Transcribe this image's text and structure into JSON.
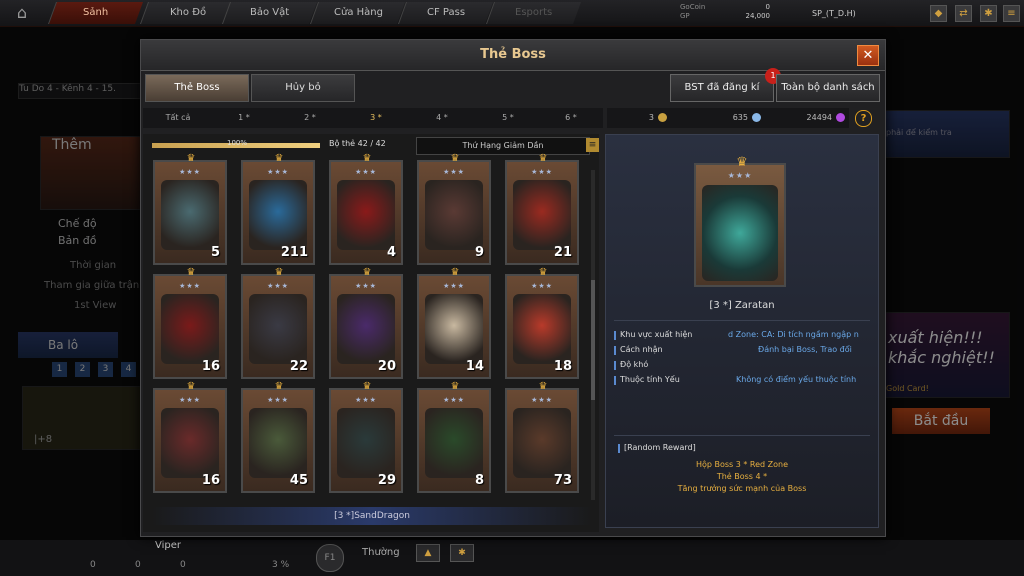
{
  "topnav": {
    "tabs": [
      "Sảnh",
      "Kho Đồ",
      "Bảo Vật",
      "Cửa Hàng",
      "CF Pass",
      "Esports"
    ],
    "gocoin_label": "GoCoin",
    "gp_label": "GP",
    "gocoin_value": "0",
    "gp_value": "24,000",
    "player": "SP_(T_D.H)"
  },
  "background": {
    "channel": "Tu Do 4 - Kênh 4 - 15.",
    "them": "Thêm",
    "che_do": "Chế độ",
    "ban_do": "Bản đồ",
    "thoi_gian": "Thời gian",
    "tham_gia": "Tham gia giữa trận",
    "first_view": "1st View",
    "ba_lo": "Ba lô",
    "slots": [
      "1",
      "2",
      "3",
      "4"
    ],
    "plus8": "|+8",
    "hint": "phải để kiểm tra",
    "xuat_hien": "xuất hiện!!!",
    "khac_nghiet": "khắc nghiệt!!",
    "gold_card": "Gold Card!",
    "bat_dau": "Bắt đầu",
    "viper": "Viper",
    "mode": "Thường",
    "percent": "3 %",
    "zeros": [
      "0",
      "0",
      "0"
    ]
  },
  "modal": {
    "title": "Thẻ Boss",
    "close": "✕",
    "tabs": [
      "Thẻ Boss",
      "Hủy bỏ"
    ],
    "btn_registered": "BST đã đăng kí",
    "btn_registered_badge": "1",
    "btn_all": "Toàn bộ danh sách",
    "filters": [
      "Tất cả",
      "1 *",
      "2 *",
      "3 *",
      "4 *",
      "5 *",
      "6 *"
    ],
    "selected_filter": 3,
    "resources": [
      "3",
      "635",
      "24494"
    ],
    "help": "?",
    "progress_pct_label": "100%",
    "progress_fraction": 1.0,
    "set_count": "Bộ thẻ 42 / 42",
    "sort_label": "Thứ Hạng Giảm Dần",
    "selected_card_name": "[3 *]SandDragon"
  },
  "cards": [
    {
      "count": "5",
      "color": "#4a6a70"
    },
    {
      "count": "211",
      "color": "#2a6a9a"
    },
    {
      "count": "4",
      "color": "#8a1a1a"
    },
    {
      "count": "9",
      "color": "#5a3a34"
    },
    {
      "count": "21",
      "color": "#9a2a20"
    },
    {
      "count": "16",
      "color": "#7a1a1a"
    },
    {
      "count": "22",
      "color": "#3a3a44"
    },
    {
      "count": "20",
      "color": "#4a2a6a"
    },
    {
      "count": "14",
      "color": "#c8b8a0"
    },
    {
      "count": "18",
      "color": "#b83a2a"
    },
    {
      "count": "16",
      "color": "#6a2a2a"
    },
    {
      "count": "45",
      "color": "#4a5a3a"
    },
    {
      "count": "29",
      "color": "#2a3a3a"
    },
    {
      "count": "8",
      "color": "#2a4a2a"
    },
    {
      "count": "73",
      "color": "#5a3a2a"
    }
  ],
  "detail": {
    "name": "[3 *] Zaratan",
    "rows": [
      {
        "label": "Khu vực xuất hiện",
        "value": "d Zone: CA: Di tích ngầm ngập n"
      },
      {
        "label": "Cách nhận",
        "value": "Đánh bại Boss, Trao đổi"
      },
      {
        "label": "Độ khó",
        "value": ""
      },
      {
        "label": "Thuộc tính Yếu",
        "value": "Không có điểm yếu thuộc tính"
      }
    ],
    "reward_title": "[Random Reward]",
    "rewards": [
      "Hộp Boss 3 * Red Zone",
      "Thẻ Boss 4 *",
      "Tăng trưởng sức mạnh của Boss"
    ]
  },
  "colors": {
    "accent": "#e8c890",
    "gold": "#e8b040",
    "blue": "#6aa8e8"
  }
}
